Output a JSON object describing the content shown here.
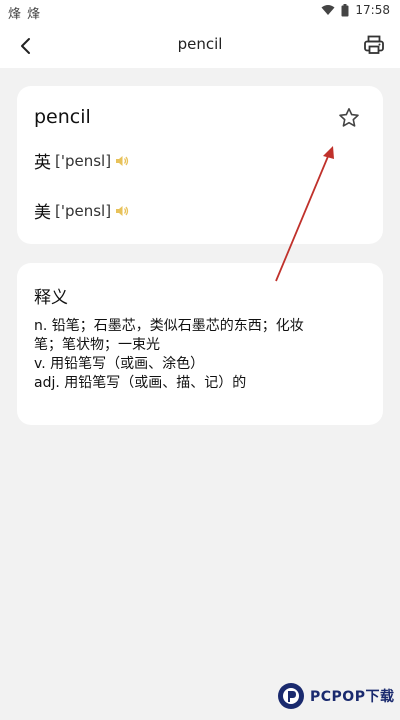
{
  "status_bar": {
    "left_icons": "烽 烽",
    "time": "17:58"
  },
  "header": {
    "title": "pencil"
  },
  "word_card": {
    "word": "pencil",
    "pronunciations": [
      {
        "label": "英",
        "phonetic": "['pensl]"
      },
      {
        "label": "美",
        "phonetic": "['pensl]"
      }
    ]
  },
  "definition_card": {
    "heading": "释义",
    "lines": [
      "n. 铅笔；石墨芯，类似石墨芯的东西；化妆",
      "笔；笔状物；一束光",
      "v. 用铅笔写（或画、涂色）",
      "adj. 用铅笔写（或画、描、记）的"
    ]
  },
  "colors": {
    "annotation_arrow": "#c0312b",
    "speaker": "#e8c25a",
    "background": "#f2f2f2",
    "card": "#ffffff"
  },
  "icons": [
    "back-arrow-icon",
    "printer-icon",
    "star-icon",
    "speaker-icon",
    "wifi-icon",
    "battery-icon"
  ]
}
